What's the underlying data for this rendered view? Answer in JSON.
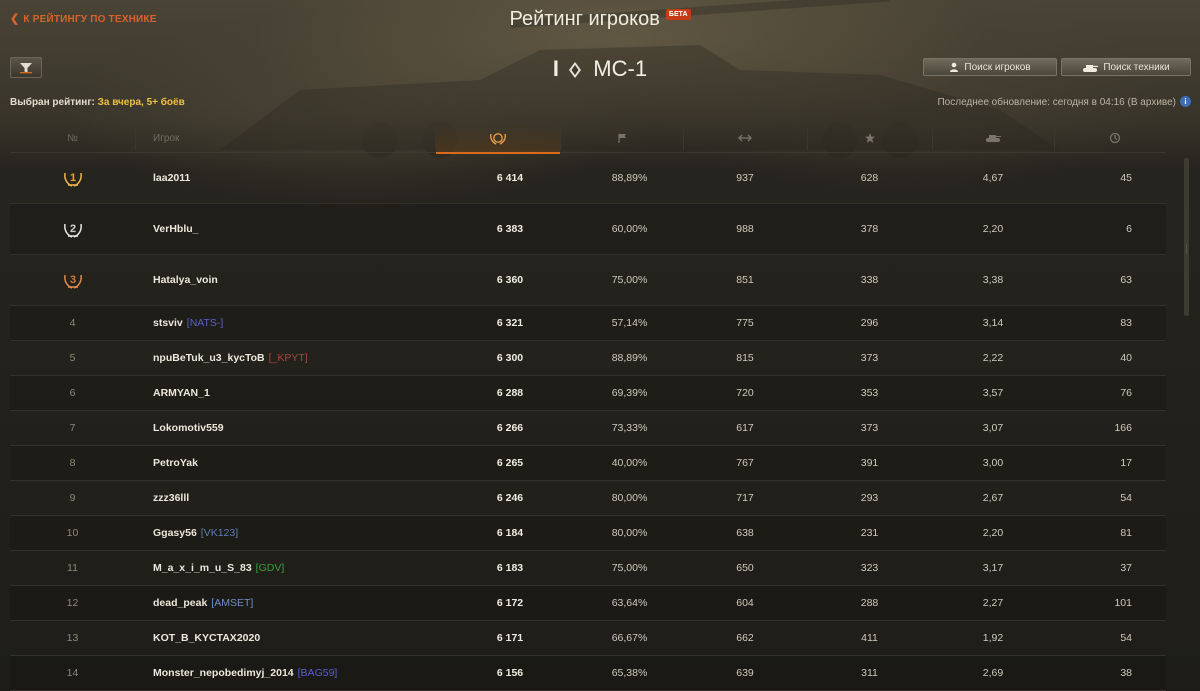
{
  "header": {
    "back_link": "К РЕЙТИНГУ ПО ТЕХНИКЕ",
    "title": "Рейтинг игроков",
    "beta_badge": "БЕТА",
    "tank_tier": "I",
    "tank_name": "МС-1",
    "search_players": "Поиск игроков",
    "search_tech": "Поиск техники",
    "rating_label": "Выбран рейтинг:",
    "rating_value": "За вчера, 5+ боёв",
    "last_update": "Последнее обновление: сегодня в 04:16 (В архиве)",
    "info_icon": "i"
  },
  "table": {
    "col_pos": "№",
    "col_player": "Игрок",
    "icons": [
      "rating-laurel-icon",
      "flag-icon",
      "damage-icon",
      "star-icon",
      "tank-icon",
      "battles-icon"
    ],
    "accent_color": "#d86a1c",
    "rows": [
      {
        "pos": "1",
        "medal": "gold",
        "name": "laa2011",
        "clan": "",
        "clan_color": "",
        "rating": "6 414",
        "winrate": "88,89%",
        "damage": "937",
        "xp": "628",
        "frags": "4,67",
        "battles": "45"
      },
      {
        "pos": "2",
        "medal": "silver",
        "name": "VerHblu_",
        "clan": "",
        "clan_color": "",
        "rating": "6 383",
        "winrate": "60,00%",
        "damage": "988",
        "xp": "378",
        "frags": "2,20",
        "battles": "6"
      },
      {
        "pos": "3",
        "medal": "bronze",
        "name": "Hatalya_voin",
        "clan": "",
        "clan_color": "",
        "rating": "6 360",
        "winrate": "75,00%",
        "damage": "851",
        "xp": "338",
        "frags": "3,38",
        "battles": "63"
      },
      {
        "pos": "4",
        "medal": "",
        "name": "stsviv",
        "clan": "[NATS-]",
        "clan_color": "#5a5fd0",
        "rating": "6 321",
        "winrate": "57,14%",
        "damage": "775",
        "xp": "296",
        "frags": "3,14",
        "battles": "83"
      },
      {
        "pos": "5",
        "medal": "",
        "name": "npuBeTuk_u3_kycToB",
        "clan": "[_KPYT]",
        "clan_color": "#a4493e",
        "rating": "6 300",
        "winrate": "88,89%",
        "damage": "815",
        "xp": "373",
        "frags": "2,22",
        "battles": "40"
      },
      {
        "pos": "6",
        "medal": "",
        "name": "ARMYAN_1",
        "clan": "",
        "clan_color": "",
        "rating": "6 288",
        "winrate": "69,39%",
        "damage": "720",
        "xp": "353",
        "frags": "3,57",
        "battles": "76"
      },
      {
        "pos": "7",
        "medal": "",
        "name": "Lokomotiv559",
        "clan": "",
        "clan_color": "",
        "rating": "6 266",
        "winrate": "73,33%",
        "damage": "617",
        "xp": "373",
        "frags": "3,07",
        "battles": "166"
      },
      {
        "pos": "8",
        "medal": "",
        "name": "PetroYak",
        "clan": "",
        "clan_color": "",
        "rating": "6 265",
        "winrate": "40,00%",
        "damage": "767",
        "xp": "391",
        "frags": "3,00",
        "battles": "17"
      },
      {
        "pos": "9",
        "medal": "",
        "name": "zzz36lll",
        "clan": "",
        "clan_color": "",
        "rating": "6 246",
        "winrate": "80,00%",
        "damage": "717",
        "xp": "293",
        "frags": "2,67",
        "battles": "54"
      },
      {
        "pos": "10",
        "medal": "",
        "name": "Ggasy56",
        "clan": "[VK123]",
        "clan_color": "#5b7db8",
        "rating": "6 184",
        "winrate": "80,00%",
        "damage": "638",
        "xp": "231",
        "frags": "2,20",
        "battles": "81"
      },
      {
        "pos": "11",
        "medal": "",
        "name": "M_a_x_i_m_u_S_83",
        "clan": "[GDV]",
        "clan_color": "#3aa03a",
        "rating": "6 183",
        "winrate": "75,00%",
        "damage": "650",
        "xp": "323",
        "frags": "3,17",
        "battles": "37"
      },
      {
        "pos": "12",
        "medal": "",
        "name": "dead_peak",
        "clan": "[AMSET]",
        "clan_color": "#6f8fc8",
        "rating": "6 172",
        "winrate": "63,64%",
        "damage": "604",
        "xp": "288",
        "frags": "2,27",
        "battles": "101"
      },
      {
        "pos": "13",
        "medal": "",
        "name": "KOT_B_KYCTAX2020",
        "clan": "",
        "clan_color": "",
        "rating": "6 171",
        "winrate": "66,67%",
        "damage": "662",
        "xp": "411",
        "frags": "1,92",
        "battles": "54"
      },
      {
        "pos": "14",
        "medal": "",
        "name": "Monster_nepobedimyj_2014",
        "clan": "[BAG59]",
        "clan_color": "#5a5fd0",
        "rating": "6 156",
        "winrate": "65,38%",
        "damage": "639",
        "xp": "311",
        "frags": "2,69",
        "battles": "38"
      }
    ]
  },
  "scroll": {
    "position": 0.0,
    "visible_fraction": 0.3
  }
}
